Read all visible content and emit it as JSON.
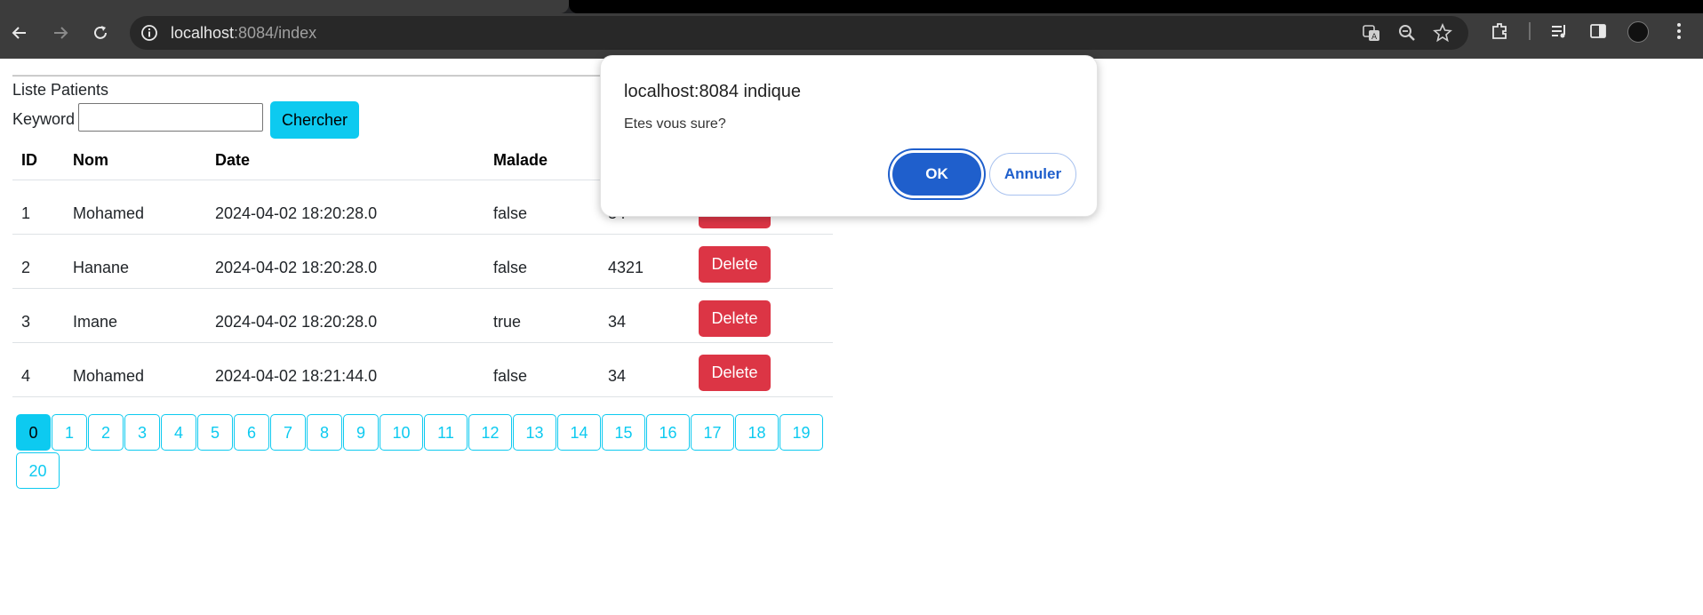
{
  "browser": {
    "url_host": "localhost",
    "url_rest": ":8084/index"
  },
  "page": {
    "title": "Liste Patients",
    "keyword_label": "Keyword",
    "keyword_value": "",
    "search_label": "Chercher"
  },
  "table": {
    "headers": [
      "ID",
      "Nom",
      "Date",
      "Malade",
      ""
    ],
    "rows": [
      {
        "id": "1",
        "nom": "Mohamed",
        "date": "2024-04-02 18:20:28.0",
        "malade": "false",
        "score": "34",
        "action": "Delete"
      },
      {
        "id": "2",
        "nom": "Hanane",
        "date": "2024-04-02 18:20:28.0",
        "malade": "false",
        "score": "4321",
        "action": "Delete"
      },
      {
        "id": "3",
        "nom": "Imane",
        "date": "2024-04-02 18:20:28.0",
        "malade": "true",
        "score": "34",
        "action": "Delete"
      },
      {
        "id": "4",
        "nom": "Mohamed",
        "date": "2024-04-02 18:21:44.0",
        "malade": "false",
        "score": "34",
        "action": "Delete"
      }
    ]
  },
  "pagination": {
    "pages": [
      "0",
      "1",
      "2",
      "3",
      "4",
      "5",
      "6",
      "7",
      "8",
      "9",
      "10",
      "11",
      "12",
      "13",
      "14",
      "15",
      "16",
      "17",
      "18",
      "19",
      "20"
    ],
    "active": "0"
  },
  "dialog": {
    "title": "localhost:8084 indique",
    "message": "Etes vous sure?",
    "ok_label": "OK",
    "cancel_label": "Annuler"
  },
  "colors": {
    "info": "#0dcaf0",
    "danger": "#dc3545",
    "dialog_primary": "#1f5fcc"
  }
}
